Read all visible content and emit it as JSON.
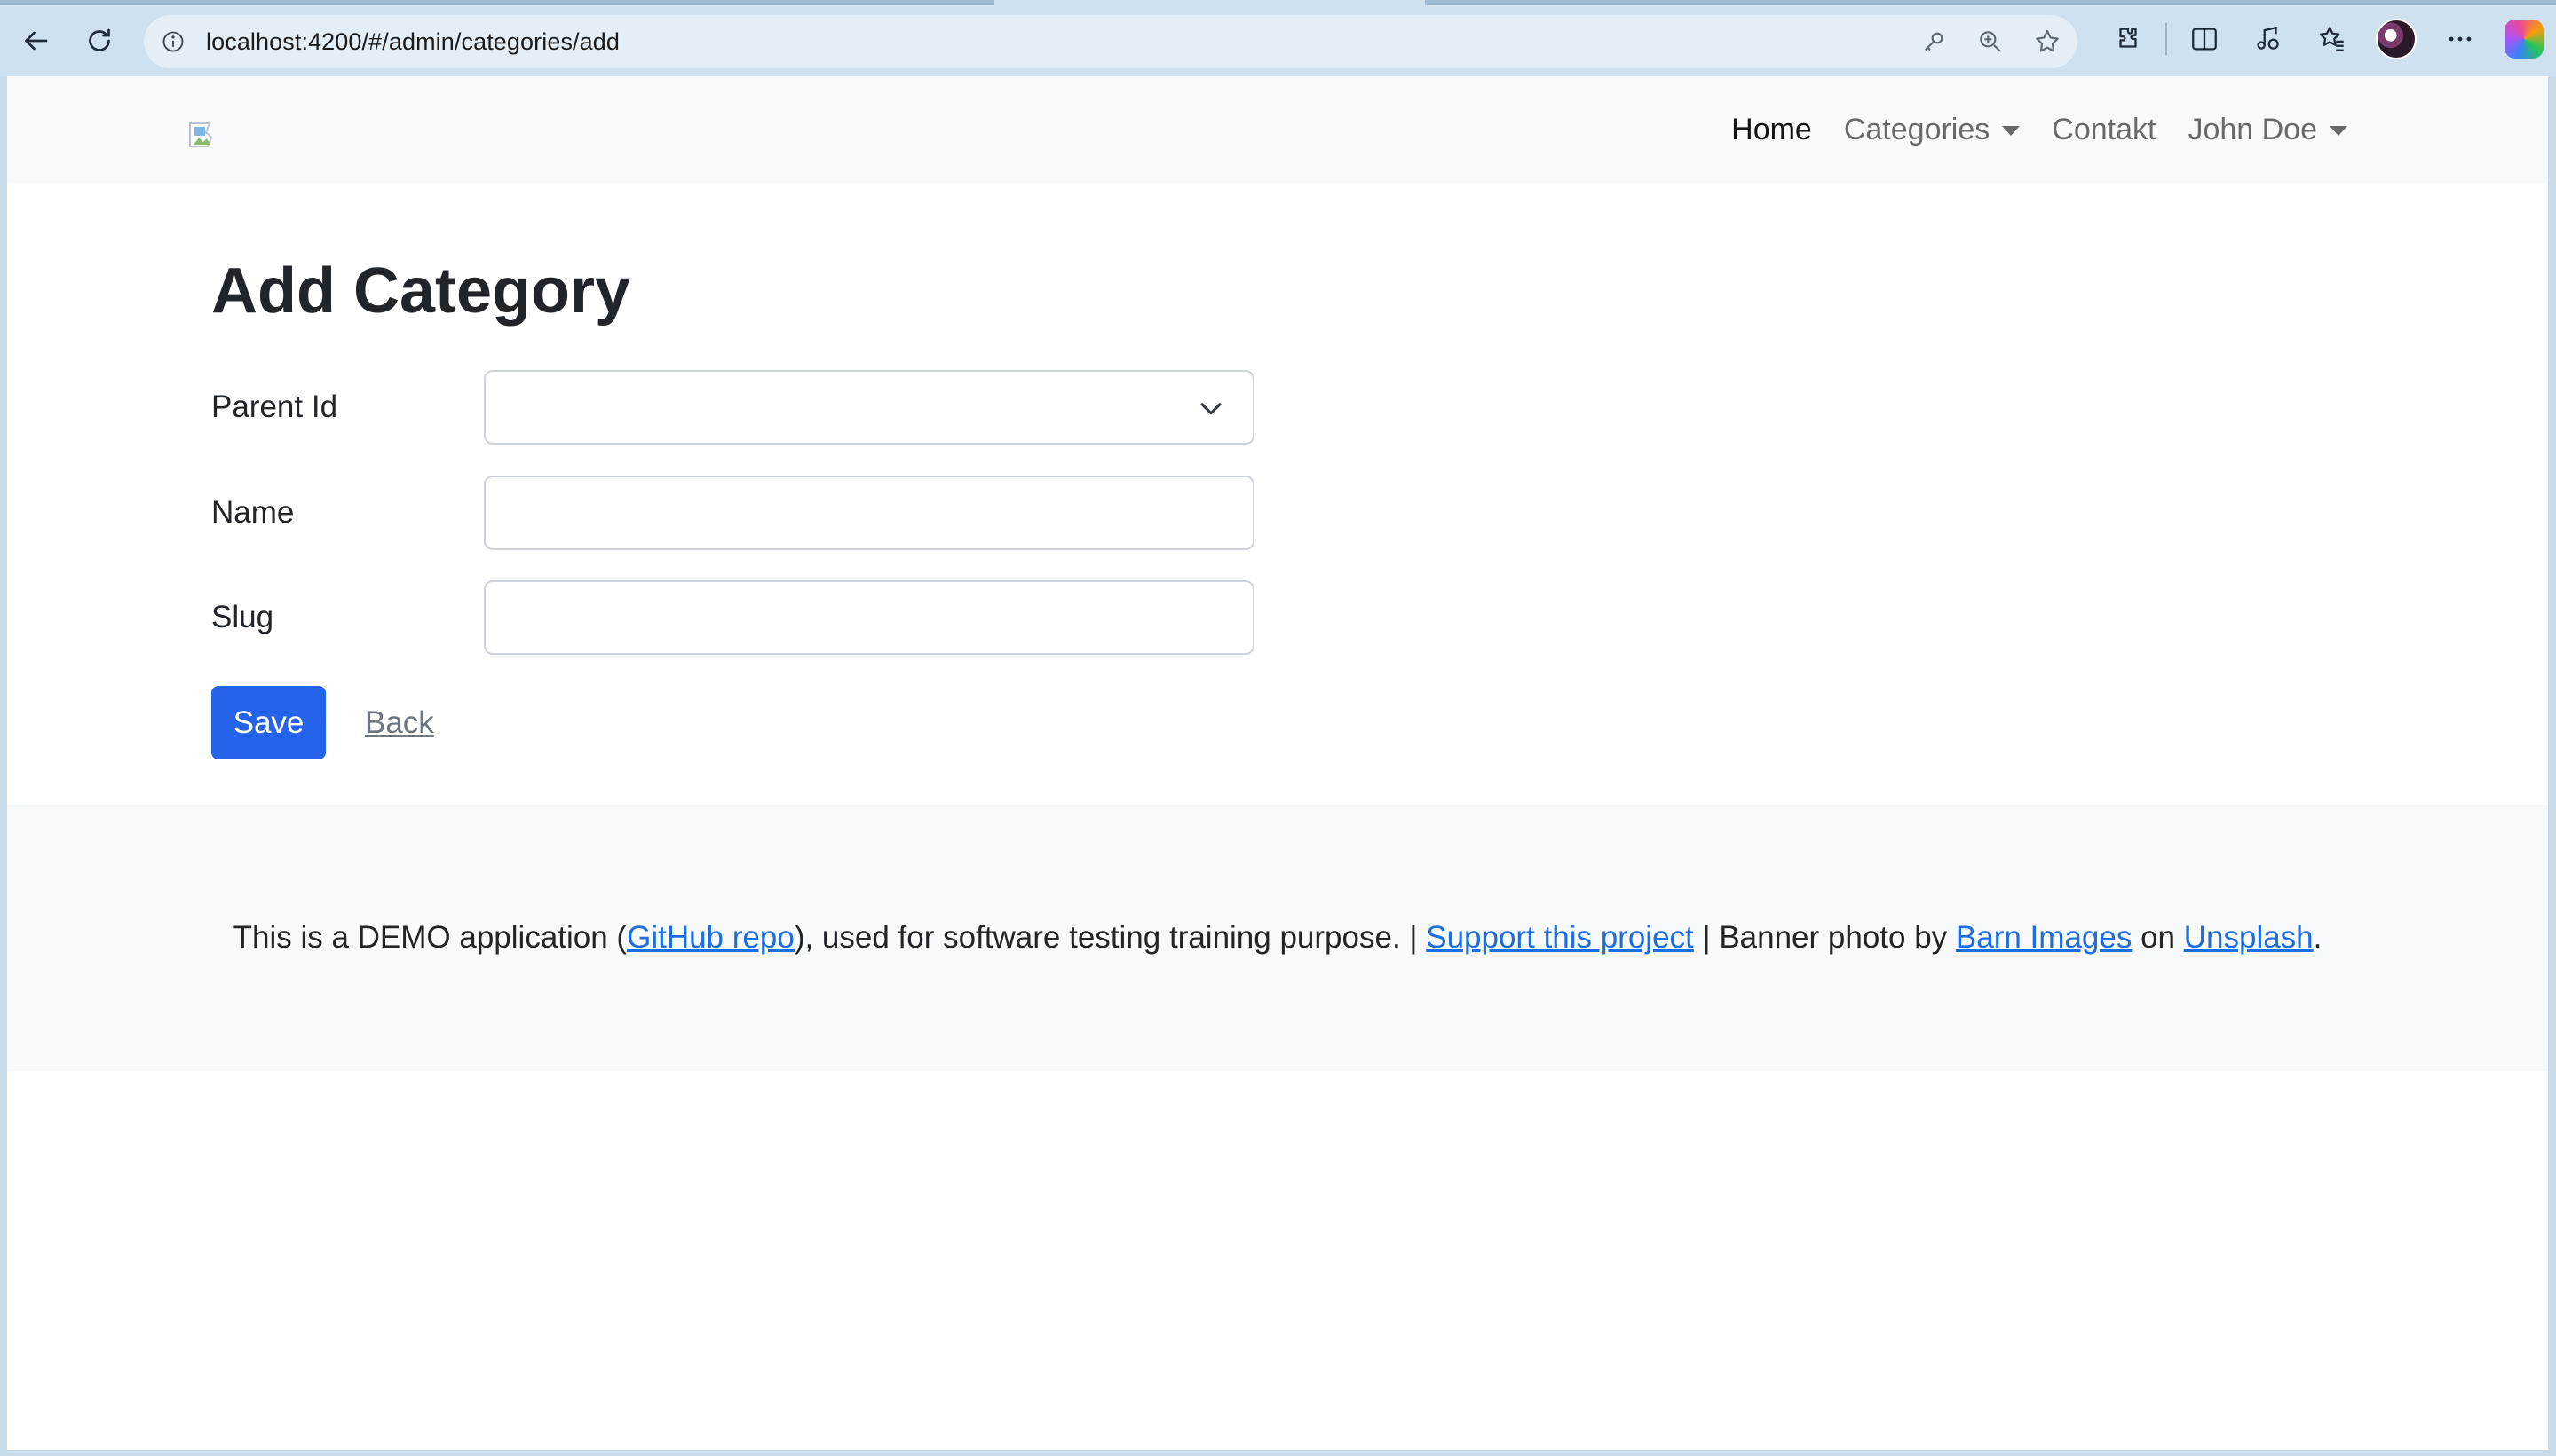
{
  "browser": {
    "url": "localhost:4200/#/admin/categories/add"
  },
  "navbar": {
    "links": {
      "home": "Home",
      "categories": "Categories",
      "contact": "Contakt",
      "user": "John Doe"
    }
  },
  "page": {
    "title": "Add Category",
    "fields": {
      "parent_id": {
        "label": "Parent Id",
        "value": ""
      },
      "name": {
        "label": "Name",
        "value": ""
      },
      "slug": {
        "label": "Slug",
        "value": ""
      }
    },
    "save_label": "Save",
    "back_label": "Back"
  },
  "footer": {
    "part1": "This is a DEMO application (",
    "github_link": "GitHub repo",
    "part2": "), used for software testing training purpose. | ",
    "support_link": "Support this project",
    "part3": " | Banner photo by ",
    "barn_link": "Barn Images",
    "part4": " on ",
    "unsplash_link": "Unsplash",
    "part5": "."
  },
  "colors": {
    "primary": "#2563eb",
    "link": "#1d6de0",
    "navbar_bg": "#f8f9fa",
    "chrome_bg": "#cfe0ee"
  }
}
